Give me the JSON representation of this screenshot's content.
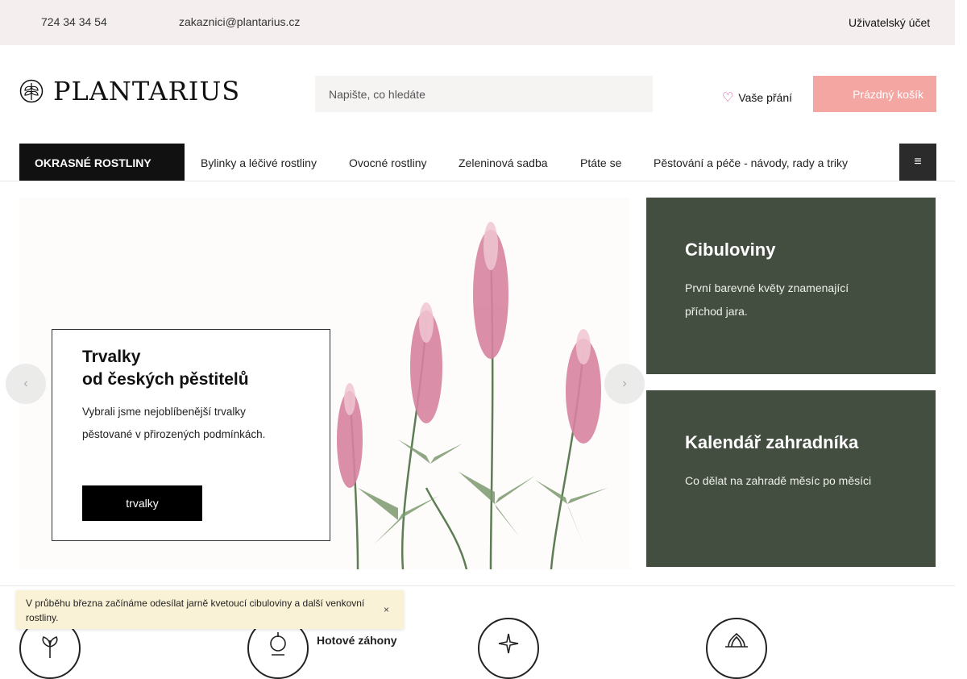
{
  "topbar": {
    "phone": "724 34 34 54",
    "email": "zakaznici@plantarius.cz",
    "account": "Uživatelský účet"
  },
  "header": {
    "logo_text": "PLANTARIUS",
    "search_placeholder": "Napište, co hledáte",
    "wishlist": "Vaše přání",
    "cart": "Prázdný košík"
  },
  "nav": {
    "main_category": "OKRASNÉ ROSTLINY",
    "items": [
      "Bylinky a léčivé rostliny",
      "Ovocné rostliny",
      "Zeleninová sadba",
      "Ptáte se",
      "Pěstování a péče - návody, rady a triky"
    ]
  },
  "hero": {
    "title_line1": "Trvalky",
    "title_line2": "od českých pěstitelů",
    "text": "Vybrali jsme nejoblíbenější trvalky pěstované v přirozených podmínkách.",
    "cta": "trvalky"
  },
  "promos": [
    {
      "title": "Cibuloviny",
      "text": "První barevné květy znamenající příchod jara."
    },
    {
      "title": "Kalendář zahradníka",
      "text": "Co dělat na zahradě měsíc po měsíci"
    }
  ],
  "categories": [
    {
      "label": ""
    },
    {
      "label": "Hotové záhony"
    },
    {
      "label": ""
    },
    {
      "label": ""
    }
  ],
  "notice": {
    "text": "V průběhu března začínáme odesílat jarně kvetoucí cibuloviny a další venkovní rostliny.",
    "close": "×"
  },
  "colors": {
    "topbar_bg": "#f4eeee",
    "cart_bg": "#f4a6a2",
    "promo_bg": "#434e40",
    "nav_main_bg": "#111111",
    "notice_bg": "#faf2d6"
  }
}
